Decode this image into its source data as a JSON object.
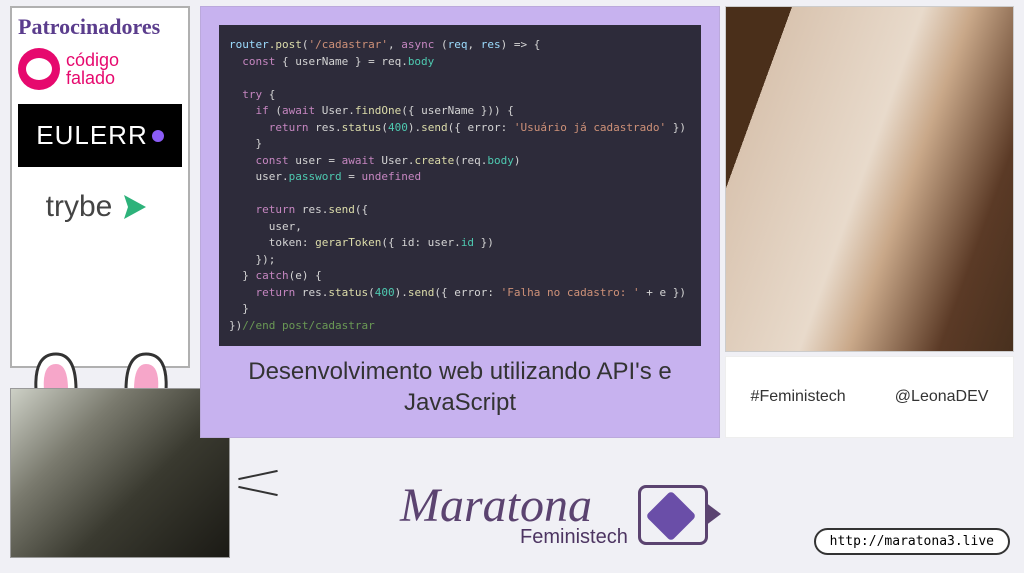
{
  "sponsors": {
    "title": "Patrocinadores",
    "codigo": {
      "line1": "código",
      "line2": "falado"
    },
    "eulerr": "EULERR",
    "trybe": "trybe"
  },
  "slide": {
    "title": "Desenvolvimento web utilizando API's e JavaScript",
    "code": {
      "l1a": "router",
      "l1b": ".post",
      "l1c": "(",
      "l1d": "'/cadastrar'",
      "l1e": ", ",
      "l1f": "async",
      "l1g": " (",
      "l1h": "req",
      "l1i": ", ",
      "l1j": "res",
      "l1k": ") => {",
      "l2a": "  const",
      "l2b": " { userName } = req.",
      "l2c": "body",
      "l4a": "  try",
      "l4b": " {",
      "l5a": "    if",
      "l5b": " (",
      "l5c": "await",
      "l5d": " User.",
      "l5e": "findOne",
      "l5f": "({ userName })) {",
      "l6a": "      return",
      "l6b": " res.",
      "l6c": "status",
      "l6d": "(",
      "l6e": "400",
      "l6f": ").",
      "l6g": "send",
      "l6h": "({ error: ",
      "l6i": "'Usuário já cadastrado'",
      "l6j": " })",
      "l7": "    }",
      "l8a": "    const",
      "l8b": " user = ",
      "l8c": "await",
      "l8d": " User.",
      "l8e": "create",
      "l8f": "(req.",
      "l8g": "body",
      "l8h": ")",
      "l9a": "    user.",
      "l9b": "password",
      "l9c": " = ",
      "l9d": "undefined",
      "l11a": "    return",
      "l11b": " res.",
      "l11c": "send",
      "l11d": "({",
      "l12": "      user,",
      "l13a": "      token: ",
      "l13b": "gerarToken",
      "l13c": "({ id: user.",
      "l13d": "id",
      "l13e": " })",
      "l14": "    });",
      "l15a": "  } ",
      "l15b": "catch",
      "l15c": "(e) {",
      "l16a": "    return",
      "l16b": " res.",
      "l16c": "status",
      "l16d": "(",
      "l16e": "400",
      "l16f": ").",
      "l16g": "send",
      "l16h": "({ error: ",
      "l16i": "'Falha no cadastro: '",
      "l16j": " + e })",
      "l17": "  }",
      "l18a": "})",
      "l18b": "//end post/cadastrar"
    }
  },
  "tags": {
    "hashtag": "#Feministech",
    "handle": "@LeonaDEV"
  },
  "event": {
    "main": "Maratona",
    "sub": "Feministech"
  },
  "url": "http://maratona3.live"
}
